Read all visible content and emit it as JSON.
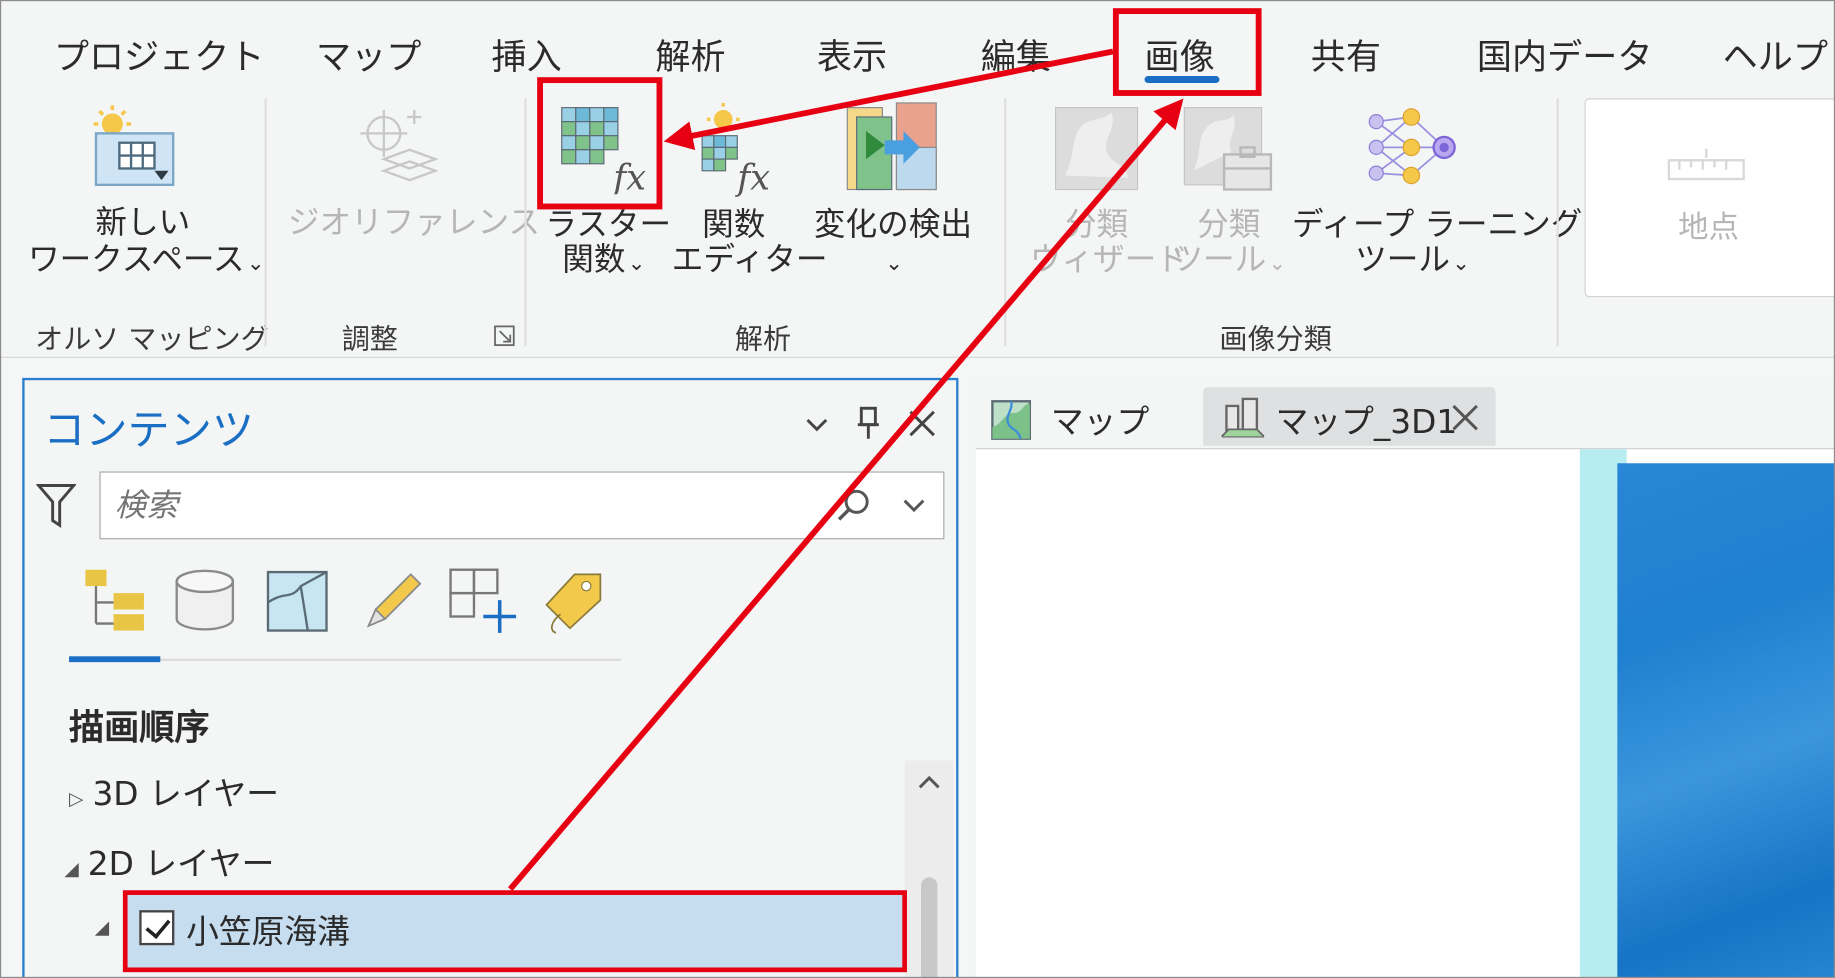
{
  "ribbon": {
    "tabs": [
      "プロジェクト",
      "マップ",
      "挿入",
      "解析",
      "表示",
      "編集",
      "画像",
      "共有",
      "国内データ",
      "ヘルプ"
    ],
    "active_tab": "画像",
    "buttons": {
      "new_workspace_line1": "新しい",
      "new_workspace_line2": "ワークスペース",
      "georeference": "ジオリファレンス",
      "raster_function_line1": "ラスター",
      "raster_function_line2": "関数",
      "function_editor_line1": "関数",
      "function_editor_line2": "エディター",
      "change_detection": "変化の検出",
      "classify_wizard_line1": "分類",
      "classify_wizard_line2": "ウィザード",
      "classify_tools_line1": "分類",
      "classify_tools_line2": "ツール",
      "deep_learning_line1": "ディープ ラーニング",
      "deep_learning_line2": "ツール",
      "location": "地点"
    },
    "groups": {
      "ortho_mapping": "オルソ マッピング",
      "adjust": "調整",
      "analysis": "解析",
      "image_classification": "画像分類"
    },
    "dropdown_glyph": "⌄"
  },
  "contents": {
    "title": "コンテンツ",
    "search_placeholder": "検索",
    "section": "描画順序",
    "tree": {
      "layer_3d": "3D レイヤー",
      "layer_2d": "2D レイヤー",
      "layer_item": "小笠原海溝"
    }
  },
  "map": {
    "tabs": [
      "マップ",
      "マップ_3D1"
    ]
  },
  "colors": {
    "accent": "#1a6fc4",
    "annotation": "#e60012",
    "selection": "#c6dcef"
  }
}
